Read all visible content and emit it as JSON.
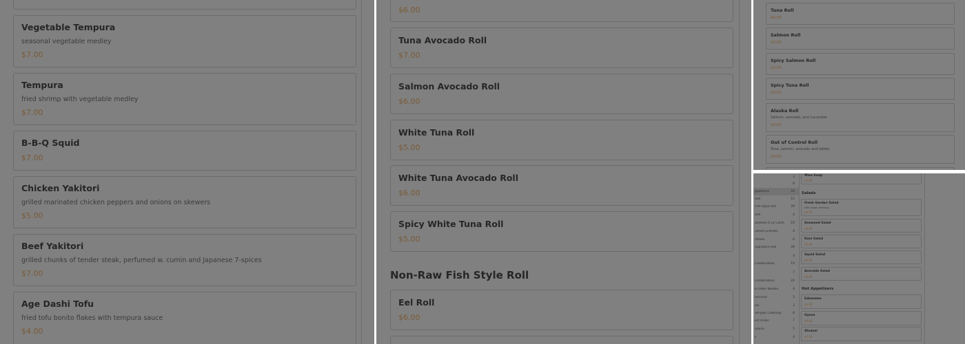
{
  "panel1": {
    "items": [
      {
        "name": "",
        "desc": "",
        "price": ""
      },
      {
        "name": "Vegetable Tempura",
        "desc": "seasonal vegetable medley",
        "price": "$7.00"
      },
      {
        "name": "Tempura",
        "desc": "fried shrimp with vegetable medley",
        "price": "$7.00"
      },
      {
        "name": "B-B-Q Squid",
        "desc": "",
        "price": "$7.00"
      },
      {
        "name": "Chicken Yakitori",
        "desc": "grilled marinated chicken peppers and onions on skewers",
        "price": "$5.00"
      },
      {
        "name": "Beef Yakitori",
        "desc": "grilled chunks of tender steak, perfumed w. cumin and Japanese 7-spices",
        "price": "$7.00"
      },
      {
        "name": "Age Dashi Tofu",
        "desc": "fried tofu bonito flakes with tempura sauce",
        "price": "$4.00"
      }
    ]
  },
  "panel2": {
    "items": [
      {
        "name": "",
        "price": "$6.00"
      },
      {
        "name": "Tuna Avocado Roll",
        "price": "$7.00"
      },
      {
        "name": "Salmon Avocado Roll",
        "price": "$6.00"
      },
      {
        "name": "White Tuna Roll",
        "price": "$5.00"
      },
      {
        "name": "White Tuna Avocado Roll",
        "price": "$6.00"
      },
      {
        "name": "Spicy White Tuna Roll",
        "price": "$5.00"
      }
    ],
    "section_title": "Non-Raw Fish Style Roll",
    "section_items": [
      {
        "name": "Eel Roll",
        "price": "$6.00"
      },
      {
        "name": "",
        "price": ""
      }
    ]
  },
  "panel3": {
    "items": [
      {
        "name": "Tuna Roll",
        "desc": "",
        "price": "$6.00"
      },
      {
        "name": "Salmon Roll",
        "desc": "",
        "price": "$5.00"
      },
      {
        "name": "Spicy Salmon Roll",
        "desc": "",
        "price": "$5.00"
      },
      {
        "name": "Spicy Tuna Roll",
        "desc": "",
        "price": "$6.00"
      },
      {
        "name": "Alaska Roll",
        "desc": "Salmon, avocado, and cucumber",
        "price": "$6.00"
      },
      {
        "name": "Out of Control Roll",
        "desc": "Tuna, salmon, avocado and tobiko",
        "price": "$8.00"
      }
    ]
  },
  "panel4": {
    "categories": [
      {
        "label": "",
        "count": "3"
      },
      {
        "label": "",
        "count": "8"
      },
      {
        "label": "ppetizers",
        "count": "24"
      },
      {
        "label": "Roll",
        "count": "15"
      },
      {
        "label": "Fish Style Roll",
        "count": "20"
      },
      {
        "label": "Roll",
        "count": "4"
      },
      {
        "label": "Sashimi A La Carte",
        "count": "10"
      },
      {
        "label": "ushimi Entrees",
        "count": "4"
      },
      {
        "label": "ntrees",
        "count": "6"
      },
      {
        "label": "Signature Roll",
        "count": "26"
      },
      {
        "label": "",
        "count": "4"
      },
      {
        "label": "Combination",
        "count": "15"
      },
      {
        "label": "",
        "count": "7"
      },
      {
        "label": "Combination",
        "count": "22"
      },
      {
        "label": "ki Udon Noodle",
        "count": "4"
      },
      {
        "label": "ied Rice",
        "count": "5"
      },
      {
        "label": "ies",
        "count": "3"
      },
      {
        "label": "Teriyaki Catering",
        "count": "6"
      },
      {
        "label": "ert Order",
        "count": "7"
      },
      {
        "label": "Sauce",
        "count": "5"
      },
      {
        "label": "s",
        "count": "4"
      }
    ],
    "top_item": {
      "name": "Miso Soup",
      "price": "$3.00"
    },
    "salads_title": "Salads",
    "salads": [
      {
        "name": "Fresh Garden Salad",
        "desc": "with ginger dressing",
        "price": "$3.50"
      },
      {
        "name": "Seaweed Salad",
        "desc": "",
        "price": "$4.00"
      },
      {
        "name": "Kani Salad",
        "desc": "",
        "price": "$5.00"
      },
      {
        "name": "Squid Salad",
        "desc": "",
        "price": "$5.00"
      },
      {
        "name": "Avocado Salad",
        "desc": "",
        "price": "$4.00"
      }
    ],
    "hot_title": "Hot Appetizers",
    "hot": [
      {
        "name": "Edamame",
        "price": "$4.00"
      },
      {
        "name": "Gyoza",
        "price": "$5.00"
      },
      {
        "name": "Shumai",
        "price": "$5.00"
      }
    ]
  },
  "colors": {
    "overlay": "#808080",
    "price": "#7a5a35",
    "text": "#262626",
    "border": "#6b6b6b"
  }
}
